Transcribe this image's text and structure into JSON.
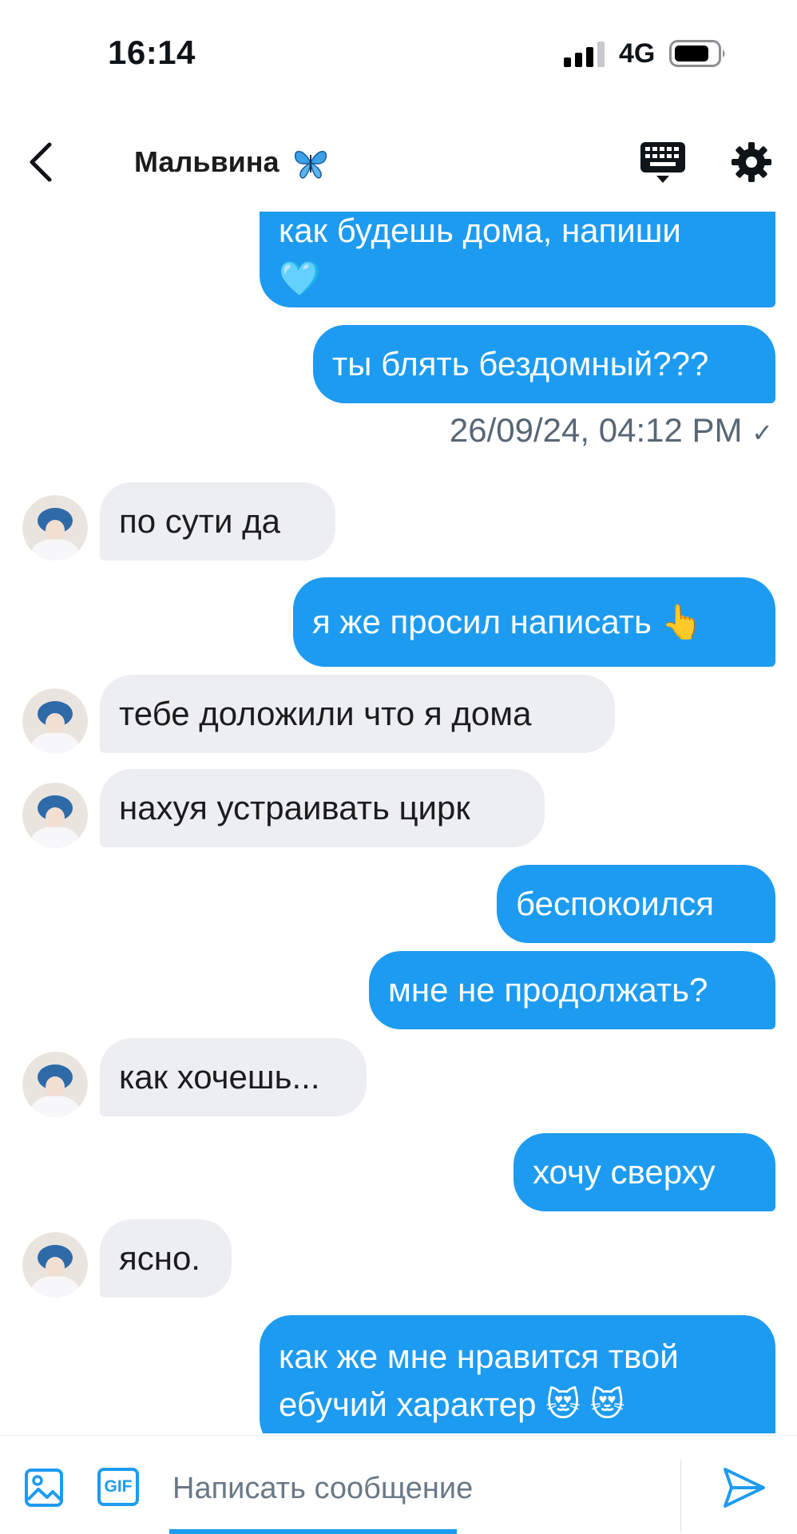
{
  "status_bar": {
    "time": "16:14",
    "network": "4G"
  },
  "header": {
    "contact_name": "Мальвина",
    "icons": [
      "back-icon",
      "butterfly-icon",
      "keyboard-icon",
      "gear-icon"
    ]
  },
  "messages": [
    {
      "dir": "out",
      "lines": [
        "как будешь дома, напиши",
        "🩵"
      ]
    },
    {
      "dir": "out",
      "lines": [
        "ты блять бездомный???"
      ]
    },
    {
      "timestamp": "26/09/24, 04:12 PM",
      "read": "✓"
    },
    {
      "dir": "in",
      "lines": [
        "по сути да"
      ]
    },
    {
      "dir": "out",
      "lines": [
        "я же просил написать 👆"
      ]
    },
    {
      "dir": "in",
      "lines": [
        "тебе доложили что я дома"
      ]
    },
    {
      "dir": "in",
      "lines": [
        "нахуя устраивать цирк"
      ]
    },
    {
      "dir": "out",
      "lines": [
        "беспокоился"
      ]
    },
    {
      "dir": "out",
      "lines": [
        "мне не продолжать?"
      ]
    },
    {
      "dir": "in",
      "lines": [
        "как хочешь..."
      ]
    },
    {
      "dir": "out",
      "lines": [
        "хочу сверху"
      ]
    },
    {
      "dir": "in",
      "lines": [
        "ясно."
      ]
    },
    {
      "dir": "out",
      "lines": [
        "как же мне нравится твой",
        "ебучий характер 😻 😻"
      ]
    }
  ],
  "composer": {
    "placeholder": "Написать сообщение",
    "gif_label": "GIF"
  },
  "colors": {
    "accent": "#1d9bf0",
    "incoming_bubble": "#eceef1",
    "timestamp": "#586675"
  }
}
